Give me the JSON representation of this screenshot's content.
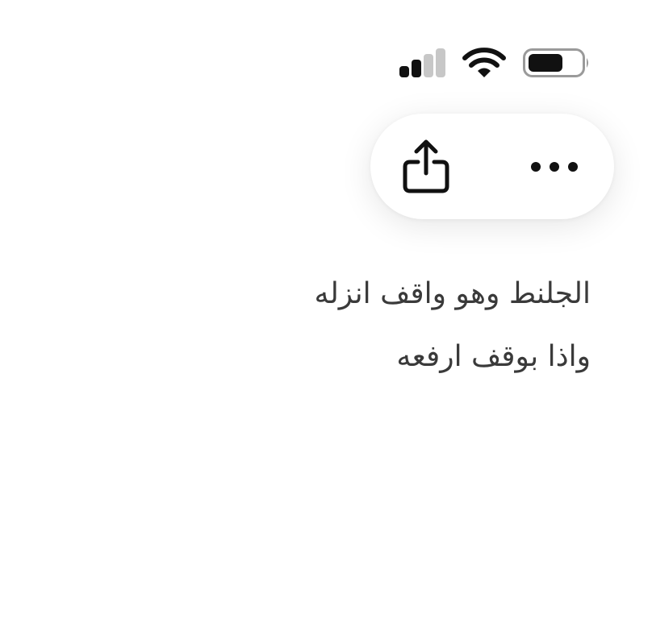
{
  "status_bar": {
    "signal_icon": "cellular-signal-icon",
    "signal_strength_bars": 2,
    "signal_total_bars": 4,
    "wifi_icon": "wifi-icon",
    "battery_icon": "battery-icon",
    "battery_level": 0.65
  },
  "toolbar": {
    "share_icon": "share-icon",
    "more_icon": "more-options-icon"
  },
  "note": {
    "lines": [
      "الجلنط وهو واقف انزله",
      "واذا بوقف ارفعه"
    ]
  },
  "colors": {
    "text": "#3a3a3a",
    "icon": "#111111",
    "inactive_signal": "#c7c7c7",
    "background": "#ffffff"
  }
}
